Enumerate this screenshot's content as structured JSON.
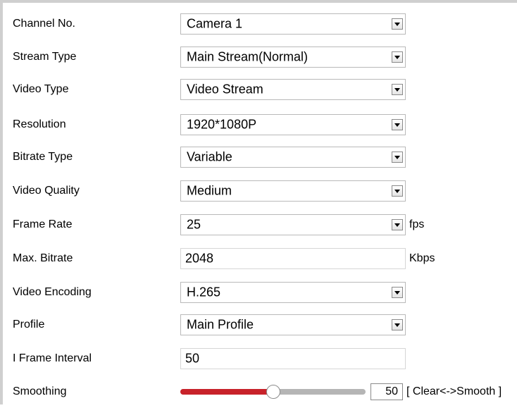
{
  "form": {
    "channel_no": {
      "label": "Channel No.",
      "value": "Camera 1"
    },
    "stream_type": {
      "label": "Stream Type",
      "value": "Main Stream(Normal)"
    },
    "video_type": {
      "label": "Video Type",
      "value": "Video Stream"
    },
    "resolution": {
      "label": "Resolution",
      "value": "1920*1080P"
    },
    "bitrate_type": {
      "label": "Bitrate Type",
      "value": "Variable"
    },
    "video_quality": {
      "label": "Video Quality",
      "value": "Medium"
    },
    "frame_rate": {
      "label": "Frame Rate",
      "value": "25",
      "unit": "fps"
    },
    "max_bitrate": {
      "label": "Max. Bitrate",
      "value": "2048",
      "unit": "Kbps"
    },
    "video_encoding": {
      "label": "Video Encoding",
      "value": "H.265"
    },
    "profile": {
      "label": "Profile",
      "value": "Main Profile"
    },
    "i_frame_interval": {
      "label": "I Frame Interval",
      "value": "50"
    },
    "smoothing": {
      "label": "Smoothing",
      "value": "50",
      "level": 0.5,
      "hint": "[ Clear<->Smooth ]"
    }
  },
  "colors": {
    "slider_fill": "#c8222a",
    "slider_track": "#b5b5b5",
    "frame": "#cfcfcf"
  }
}
